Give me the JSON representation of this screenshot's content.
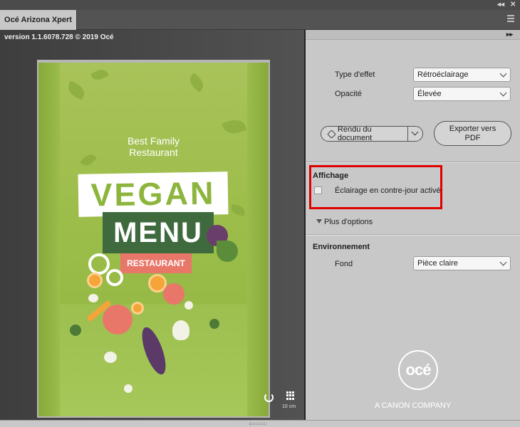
{
  "window": {
    "collapse_glyph": "◂◂",
    "close_glyph": "✕",
    "tab_title": "Océ Arizona Xpert"
  },
  "preview": {
    "version_text": "version 1.1.6078.728 © 2019 Océ",
    "poster": {
      "subtitle_line1": "Best Family",
      "subtitle_line2": "Restaurant",
      "word1": "VEGAN",
      "word2": "MENU",
      "word3": "RESTAURANT"
    },
    "scale_label": "10 cm"
  },
  "panel": {
    "collapse_glyph": "▸▸",
    "effect_type": {
      "label": "Type d'effet",
      "value": "Rétroéclairage"
    },
    "opacity": {
      "label": "Opacité",
      "value": "Élevée"
    },
    "render_button": "Rendu du document",
    "export_button_line1": "Exporter vers",
    "export_button_line2": "PDF",
    "display_section": {
      "title": "Affichage",
      "checkbox_label": "Éclairage en contre-jour activé",
      "checked": false
    },
    "more_options": "Plus d'options",
    "environment_section": {
      "title": "Environnement",
      "background_label": "Fond",
      "background_value": "Pièce claire"
    },
    "logo_text": "océ",
    "tagline": "A CANON COMPANY"
  },
  "colors": {
    "highlight": "#e00000",
    "poster_green": "#9cbd4a",
    "menu_green": "#3f6a3e",
    "salmon": "#e8776a"
  }
}
